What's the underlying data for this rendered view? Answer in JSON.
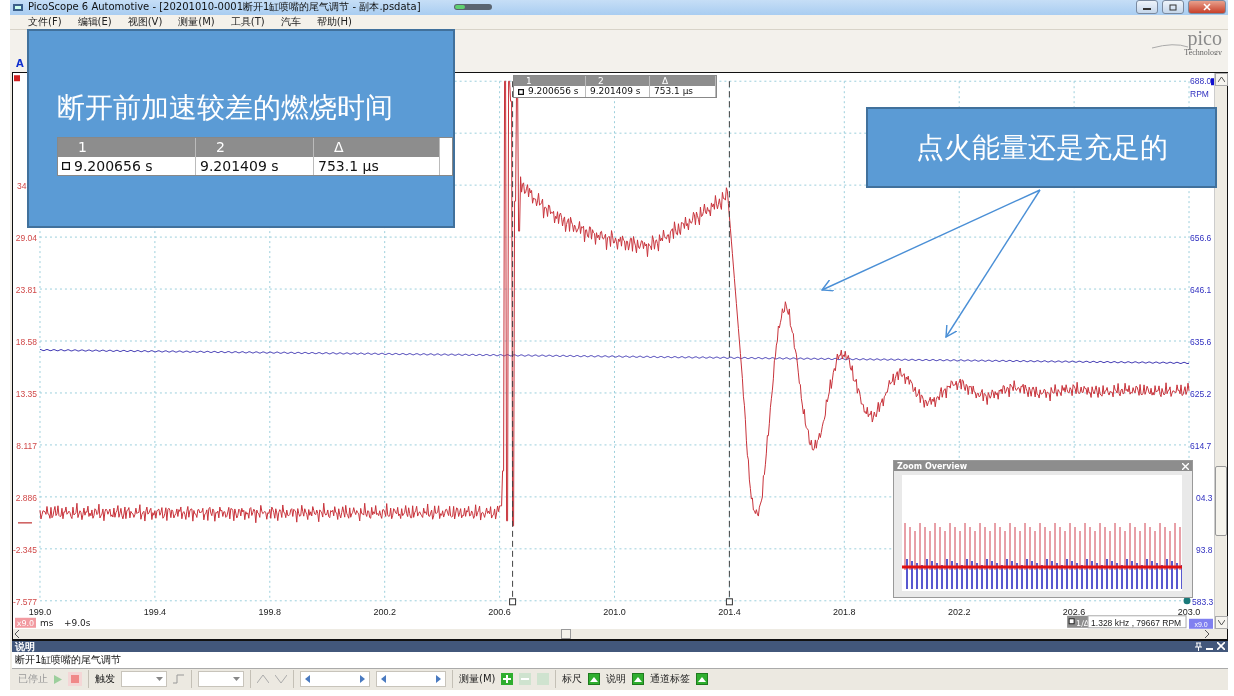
{
  "window": {
    "title": "PicoScope 6 Automotive - [20201010-0001断开1缸喷嘴的尾气调节 - 副本.psdata]"
  },
  "menu": [
    "文件(F)",
    "编辑(E)",
    "视图(V)",
    "测量(M)",
    "工具(T)",
    "汽车",
    "帮助(H)"
  ],
  "view_tabs": [
    {
      "label": "A",
      "selected": true
    }
  ],
  "logo": {
    "name": "pico",
    "tagline": "Technology"
  },
  "scope": {
    "left_axis": {
      "labels": [
        "34",
        "29.04",
        "23.81",
        "18.58",
        "13.35",
        "8.117",
        "2.886",
        "-2.345",
        "-7.577"
      ]
    },
    "right_axis": {
      "top_label": "688.0",
      "unit": "RPM",
      "labels": [
        "656.6",
        "646.1",
        "635.6",
        "625.2",
        "614.7",
        "04.3",
        "93.8",
        "583.3"
      ]
    },
    "x_axis": {
      "ticks": [
        "199.0",
        "199.4",
        "199.8",
        "200.2",
        "200.6",
        "201.0",
        "201.4",
        "201.8",
        "202.2",
        "202.6",
        "203.0"
      ],
      "unit": "ms",
      "offset": "+9.0s"
    },
    "channel_a_scale": "x9.0",
    "channel_b_scale": "x9.0",
    "cursor_table": {
      "headers": [
        "1",
        "2",
        "Δ"
      ],
      "values": [
        "9.200656 s",
        "9.201409 s",
        "753.1 µs"
      ]
    },
    "readout": {
      "label": "1/Δ",
      "value": "1.328 kHz , 79667 RPM"
    },
    "zoom_overview": {
      "title": "Zoom Overview"
    }
  },
  "callouts": [
    {
      "text": "断开前加速较差的燃烧时间",
      "cursor_table": {
        "headers": [
          "1",
          "2",
          "Δ"
        ],
        "values": [
          "9.200656 s",
          "9.201409 s",
          "753.1 µs"
        ]
      }
    },
    {
      "text": "点火能量还是充足的"
    }
  ],
  "notes_panel": {
    "title": "说明",
    "text": "断开1缸喷嘴的尾气调节"
  },
  "bottom_toolbar": {
    "status": "已停止",
    "trigger_label": "触发",
    "measure_label": "测量(M)",
    "toggles": [
      {
        "label": "标尺",
        "on": true
      },
      {
        "label": "说明",
        "on": true
      },
      {
        "label": "通道标签",
        "on": true
      }
    ]
  }
}
